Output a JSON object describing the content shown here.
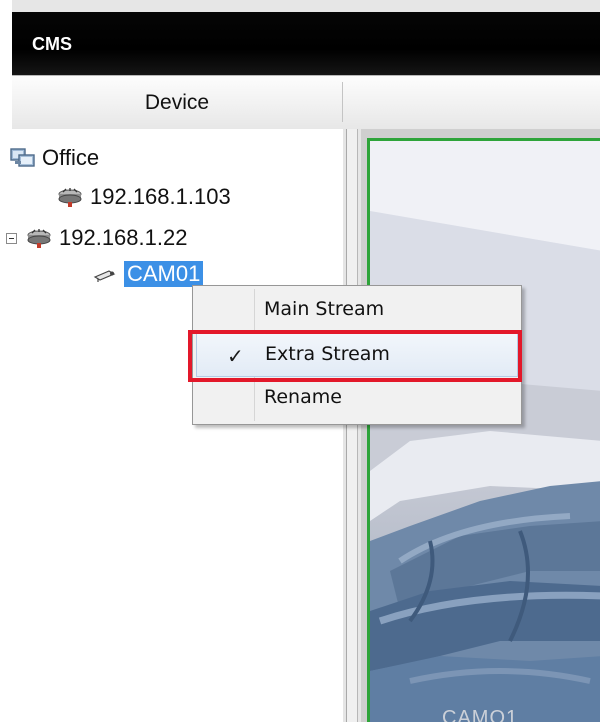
{
  "window": {
    "title": "CMS"
  },
  "tabs": {
    "device_label": "Device"
  },
  "tree": {
    "root": {
      "label": "Office",
      "icon": "monitor-group-icon"
    },
    "devices": [
      {
        "label": "192.168.1.103",
        "icon": "network-device-icon",
        "expanded": false
      },
      {
        "label": "192.168.1.22",
        "icon": "network-device-icon",
        "expanded": true
      }
    ],
    "camera": {
      "label": "CAM01",
      "icon": "camera-icon",
      "selected": true
    }
  },
  "context_menu": {
    "items": [
      {
        "label": "Main Stream",
        "checked": false
      },
      {
        "label": "Extra Stream",
        "checked": true
      },
      {
        "label": "Rename",
        "checked": false
      }
    ],
    "check_mark": "✓"
  },
  "video": {
    "overlay_label": "CAMO1"
  },
  "colors": {
    "selection": "#3c90e6",
    "video_border": "#2ea43a",
    "highlight": "#e3182a"
  }
}
